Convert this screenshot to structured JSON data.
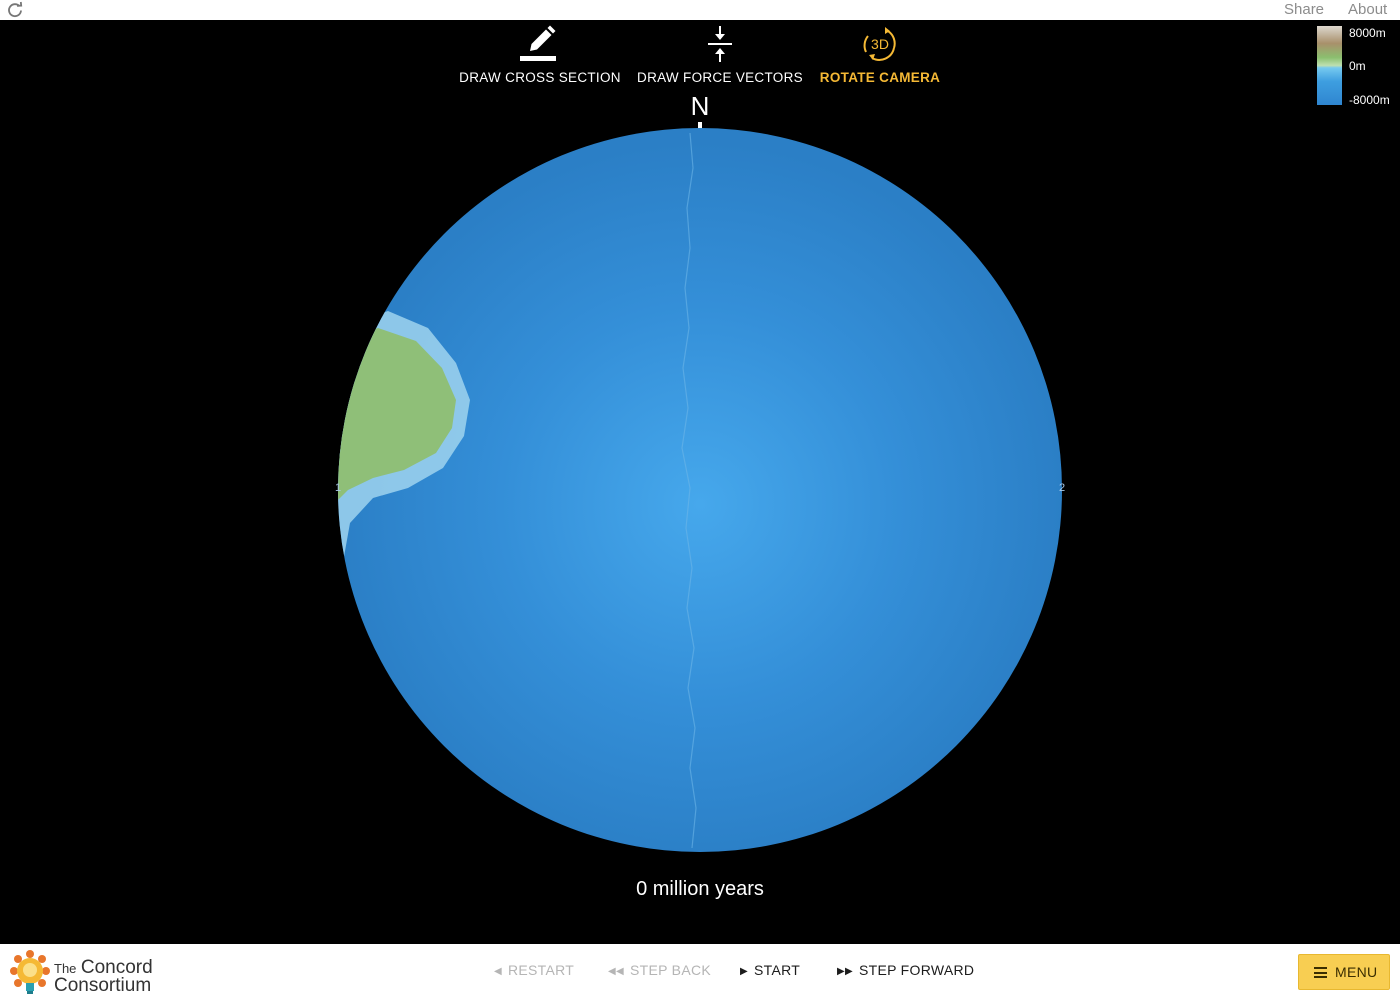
{
  "topbar": {
    "reload_icon": "reload-icon",
    "share_label": "Share",
    "about_label": "About"
  },
  "tools": {
    "cross_section_label": "DRAW CROSS SECTION",
    "force_vectors_label": "DRAW FORCE VECTORS",
    "rotate_camera_label": "ROTATE CAMERA",
    "rotate_camera_icon_text": "3D",
    "active_tool": "rotate-camera",
    "active_color": "#f5b935"
  },
  "legend": {
    "max_label": "8000m",
    "mid_label": "0m",
    "min_label": "-8000m"
  },
  "globe": {
    "north_label": "N",
    "edge_label_left": "1",
    "edge_label_right": "2",
    "ocean_color": "#2f86d0",
    "land_color": "#8bbf6f"
  },
  "timeline": {
    "time_label": "0 million years"
  },
  "controls": {
    "restart_label": "RESTART",
    "step_back_label": "STEP BACK",
    "start_label": "START",
    "step_forward_label": "STEP FORWARD",
    "menu_label": "MENU"
  },
  "brand": {
    "logo_text_the": "The",
    "logo_text_concord": "Concord",
    "logo_text_consortium": "Consortium",
    "menu_color": "#f8ce52"
  }
}
